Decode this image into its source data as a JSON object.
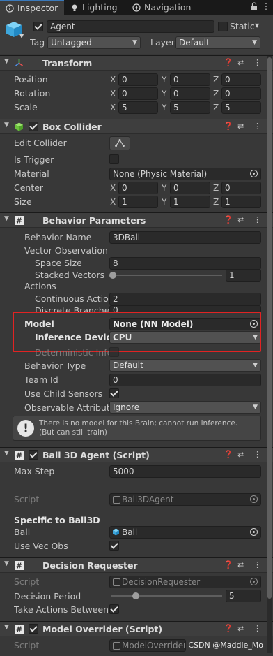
{
  "tabs": [
    {
      "label": "Inspector",
      "icon": "info-icon"
    },
    {
      "label": "Lighting",
      "icon": "bulb-icon"
    },
    {
      "label": "Navigation",
      "icon": "compass-icon"
    }
  ],
  "header": {
    "object_name": "Agent",
    "static_label": "Static",
    "tag_label": "Tag",
    "tag_value": "Untagged",
    "layer_label": "Layer",
    "layer_value": "Default"
  },
  "transform": {
    "title": "Transform",
    "rows": [
      {
        "label": "Position",
        "x": "0",
        "y": "0",
        "z": "0"
      },
      {
        "label": "Rotation",
        "x": "0",
        "y": "0",
        "z": "0"
      },
      {
        "label": "Scale",
        "x": "5",
        "y": "5",
        "z": "5"
      }
    ],
    "axis_x": "X",
    "axis_y": "Y",
    "axis_z": "Z"
  },
  "box_collider": {
    "title": "Box Collider",
    "edit_collider_label": "Edit Collider",
    "is_trigger_label": "Is Trigger",
    "material_label": "Material",
    "material_value": "None (Physic Material)",
    "center_label": "Center",
    "center": {
      "x": "0",
      "y": "0",
      "z": "0"
    },
    "size_label": "Size",
    "size": {
      "x": "1",
      "y": "1",
      "z": "1"
    }
  },
  "behavior_parameters": {
    "title": "Behavior Parameters",
    "behavior_name_label": "Behavior Name",
    "behavior_name_value": "3DBall",
    "vector_observation_label": "Vector Observation",
    "space_size_label": "Space Size",
    "space_size_value": "8",
    "stacked_vectors_label": "Stacked Vectors",
    "stacked_vectors_value": "1",
    "actions_label": "Actions",
    "continuous_actions_label": "Continuous Actions",
    "continuous_actions_value": "2",
    "discrete_branches_label": "Discrete Branches",
    "discrete_branches_value": "0",
    "model_label": "Model",
    "model_value": "None (NN Model)",
    "inference_device_label": "Inference Device",
    "inference_device_value": "CPU",
    "deterministic_label": "Deterministic Inference",
    "behavior_type_label": "Behavior Type",
    "behavior_type_value": "Default",
    "team_id_label": "Team Id",
    "team_id_value": "0",
    "use_child_sensors_label": "Use Child Sensors",
    "observable_label": "Observable Attribute Handling",
    "observable_value": "Ignore",
    "help_text": "There is no model for this Brain; cannot run inference. (But can still train)"
  },
  "ball3d_agent": {
    "title": "Ball 3D Agent (Script)",
    "max_step_label": "Max Step",
    "max_step_value": "5000",
    "script_label": "Script",
    "script_value": "Ball3DAgent",
    "specific_label": "Specific to Ball3D",
    "ball_label": "Ball",
    "ball_value": "Ball",
    "use_vec_obs_label": "Use Vec Obs"
  },
  "decision_requester": {
    "title": "Decision Requester",
    "script_label": "Script",
    "script_value": "DecisionRequester",
    "decision_period_label": "Decision Period",
    "decision_period_value": "5",
    "take_actions_label": "Take Actions Between Decisions"
  },
  "model_overrider": {
    "title": "Model Overrider (Script)",
    "script_label": "Script",
    "script_value": "ModelOverrider"
  },
  "watermark": "CSDN @Maddie_Mo",
  "colors": {
    "highlight_box": "#e12323",
    "accent": "#3a79bb"
  }
}
